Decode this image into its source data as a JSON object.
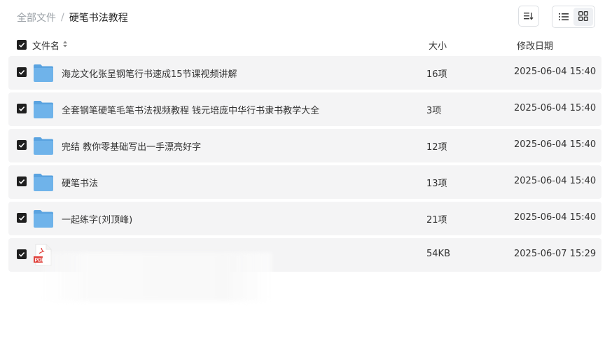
{
  "breadcrumb": {
    "root": "全部文件",
    "separator": "/",
    "current": "硬笔书法教程"
  },
  "toolbar": {
    "sort_icon": "sort-icon",
    "list_view_icon": "list-view-icon",
    "grid_view_icon": "grid-view-icon"
  },
  "table": {
    "headers": {
      "name": "文件名",
      "size": "大小",
      "date": "修改日期"
    },
    "rows": [
      {
        "type": "folder",
        "name": "海龙文化张呈钢笔行书速成15节课视频讲解",
        "size": "16项",
        "date": "2025-06-04 15:40",
        "checked": true
      },
      {
        "type": "folder",
        "name": "全套钢笔硬笔毛笔书法视频教程 钱元培庞中华行书隶书教学大全",
        "size": "3项",
        "date": "2025-06-04 15:40",
        "checked": true
      },
      {
        "type": "folder",
        "name": "完结 教你零基础写出一手漂亮好字",
        "size": "12项",
        "date": "2025-06-04 15:40",
        "checked": true
      },
      {
        "type": "folder",
        "name": "硬笔书法",
        "size": "13项",
        "date": "2025-06-04 15:40",
        "checked": true
      },
      {
        "type": "folder",
        "name": "一起练字(刘顶峰)",
        "size": "21项",
        "date": "2025-06-04 15:40",
        "checked": true
      },
      {
        "type": "pdf",
        "name": "",
        "size": "54KB",
        "date": "2025-06-07 15:29",
        "checked": true
      }
    ]
  },
  "colors": {
    "folder": "#6fb3ea",
    "folder_dark": "#5aa3e0",
    "pdf_red": "#e0403a",
    "row_bg": "#f4f4f5"
  }
}
